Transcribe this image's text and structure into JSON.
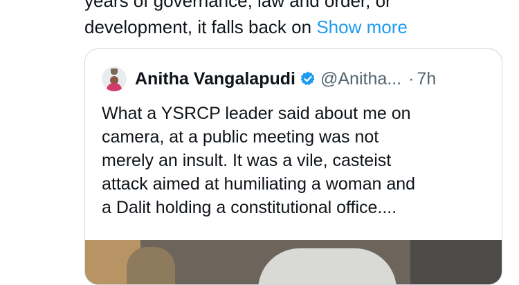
{
  "post": {
    "line1": "years of governance, law and order, or",
    "line2": "development, it falls back on",
    "show_more": "Show more"
  },
  "quote": {
    "author_name": "Anitha Vangalapudi",
    "handle": "@Anitha...",
    "separator": "·",
    "time": "7h",
    "text_lines": [
      "What a YSRCP leader said about me on",
      "camera, at a public meeting was not",
      "merely an insult. It was a vile, casteist",
      "attack aimed at humiliating a woman and",
      "a Dalit holding a constitutional office...."
    ]
  },
  "icons": {
    "verified": "verified-badge-icon",
    "avatar": "avatar"
  },
  "colors": {
    "text": "#0f1419",
    "secondary": "#536471",
    "link": "#1d9bf0",
    "border": "#cfd9de"
  }
}
